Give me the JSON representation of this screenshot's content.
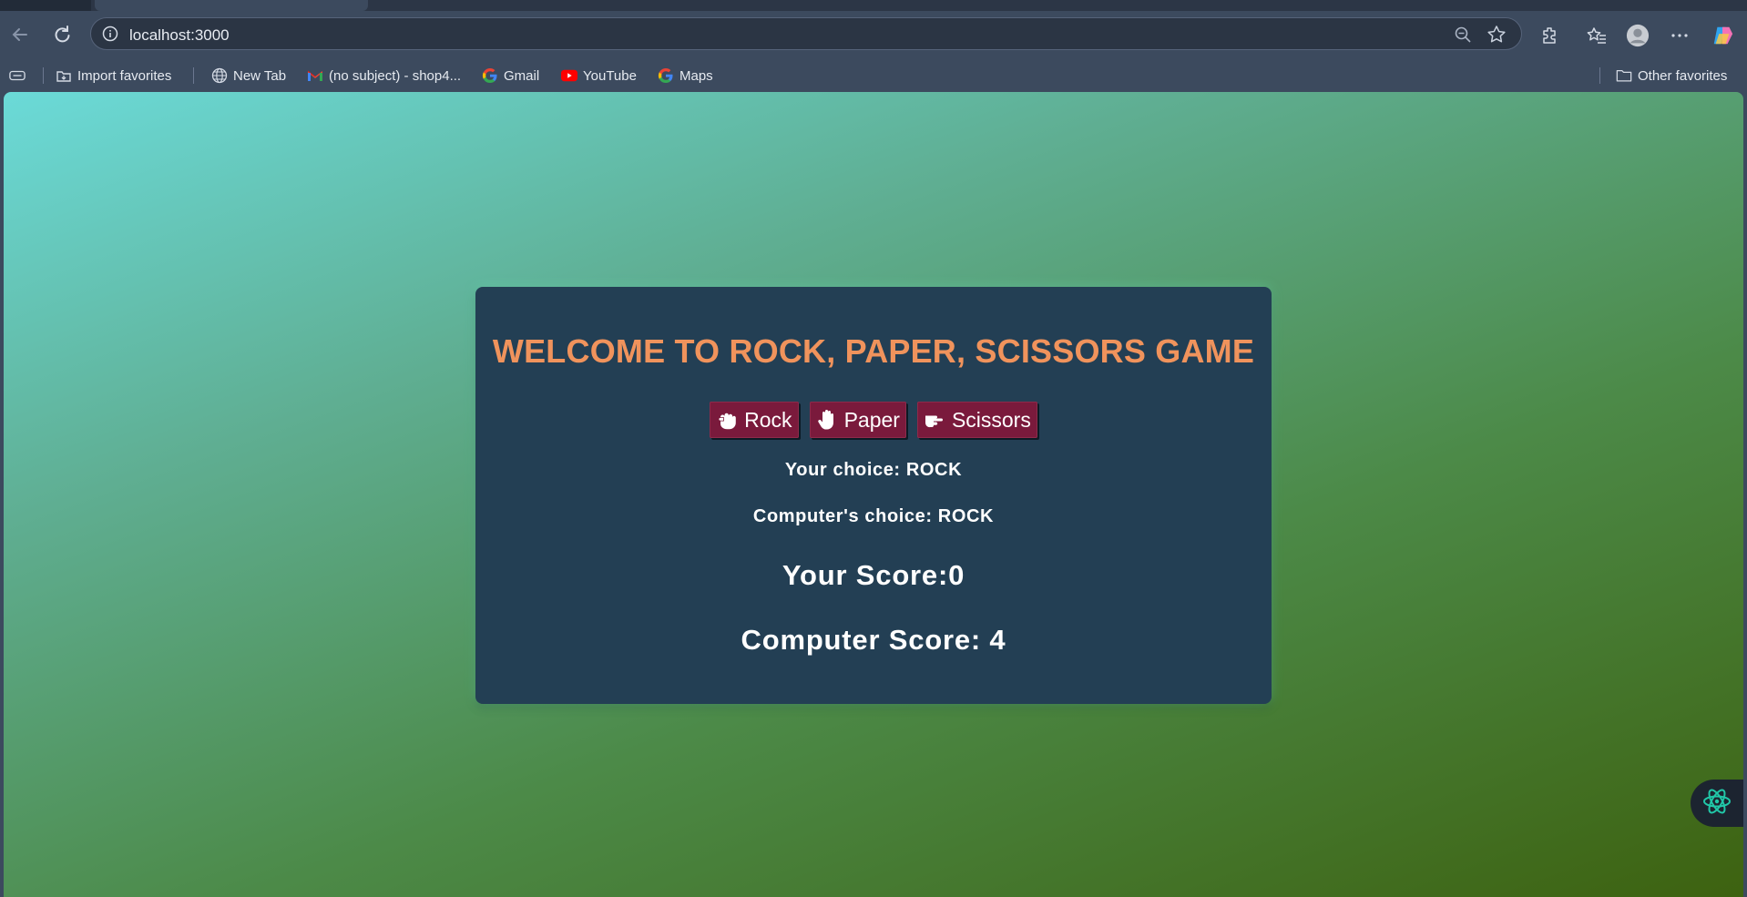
{
  "browser": {
    "url": "localhost:3000",
    "toolbar_icons": [
      "back-arrow-icon",
      "refresh-icon",
      "info-icon",
      "zoom-out-icon",
      "star-icon",
      "extensions-icon",
      "favorites-icon",
      "profile-icon",
      "more-icon",
      "copilot-icon"
    ]
  },
  "bookmarks": {
    "items": [
      {
        "label": "Import favorites",
        "icon": "import-icon"
      },
      {
        "label": "New Tab",
        "icon": "globe-icon"
      },
      {
        "label": "(no subject) - shop4...",
        "icon": "gmail-icon"
      },
      {
        "label": "Gmail",
        "icon": "google-icon"
      },
      {
        "label": "YouTube",
        "icon": "youtube-icon"
      },
      {
        "label": "Maps",
        "icon": "google-icon"
      }
    ],
    "other_favorites": "Other favorites"
  },
  "game": {
    "title": "WELCOME TO ROCK, PAPER, SCISSORS GAME",
    "buttons": {
      "rock": "Rock",
      "paper": "Paper",
      "scissors": "Scissors"
    },
    "your_choice": "Your choice: ROCK",
    "computer_choice": "Computer's choice: ROCK",
    "your_score": "Your Score:0",
    "computer_score": "Computer Score: 4"
  },
  "colors": {
    "title": "#f0935c",
    "card": "#233f54",
    "button": "#7a1a3c"
  }
}
